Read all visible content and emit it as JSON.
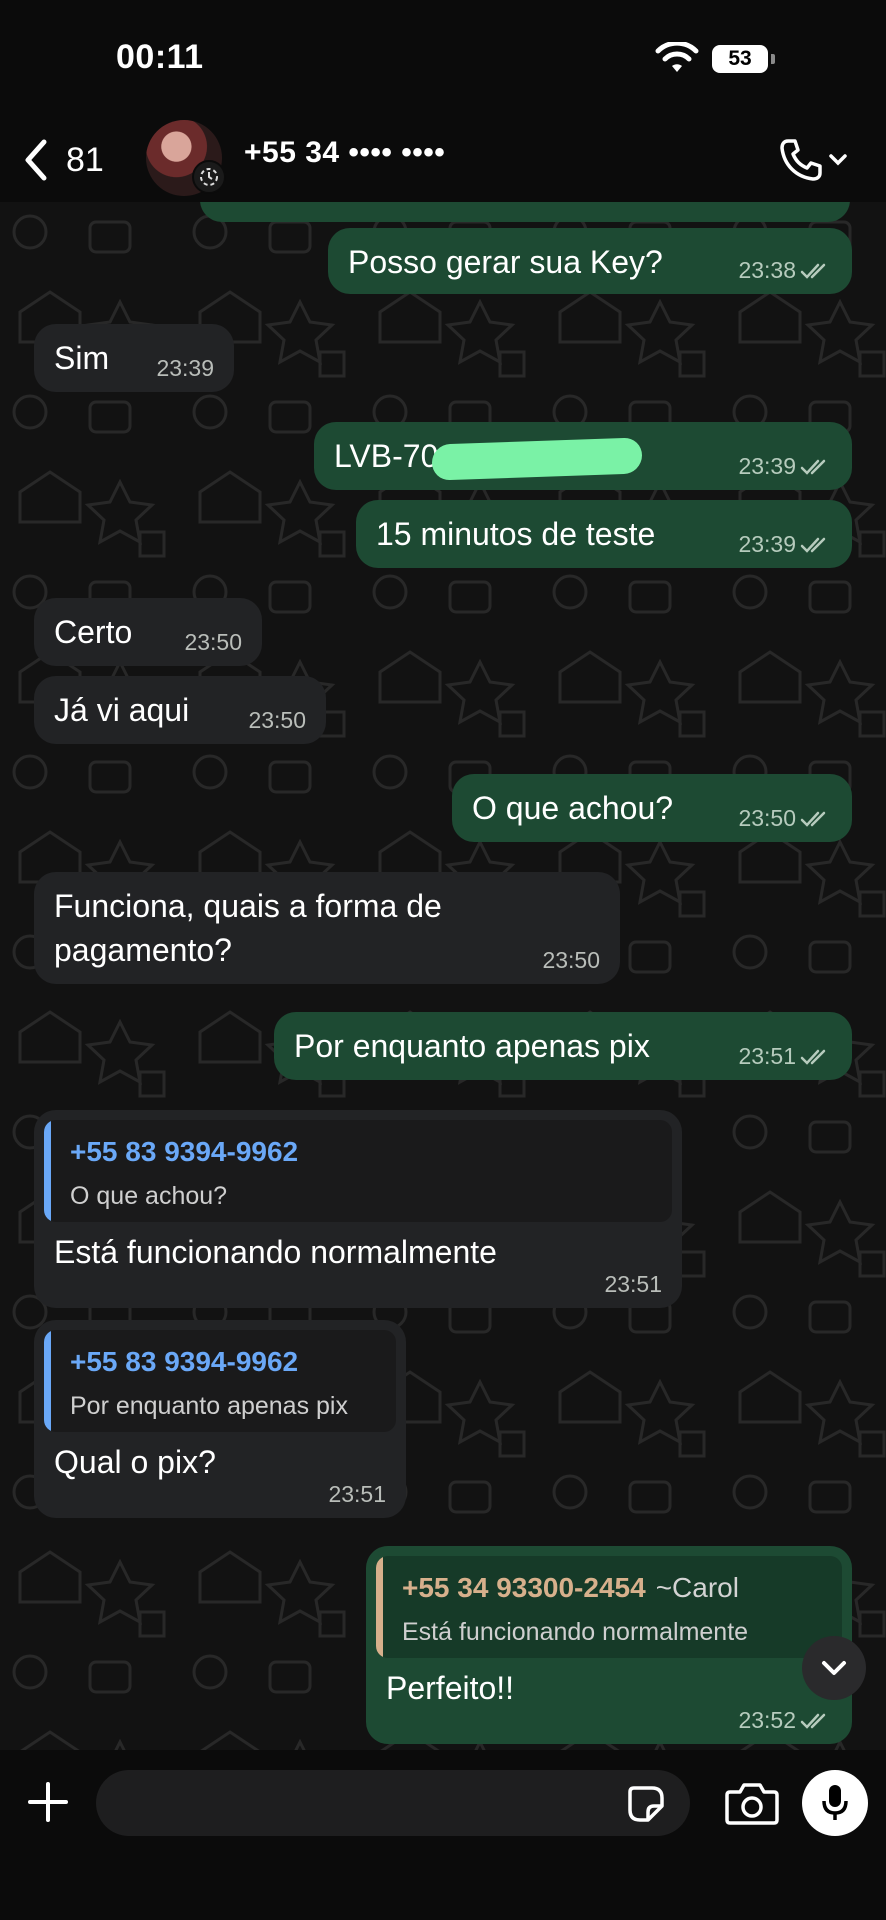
{
  "status_bar": {
    "time": "00:11",
    "battery": "53"
  },
  "header": {
    "back_count": "81",
    "contact_name": "+55 34 •••• ••••"
  },
  "messages": [
    {
      "dir": "out",
      "text": "Posso gerar sua Key?",
      "time": "23:38"
    },
    {
      "dir": "in",
      "text": "Sim",
      "time": "23:39"
    },
    {
      "dir": "out",
      "text": "LVB-70",
      "redacted": true,
      "time": "23:39"
    },
    {
      "dir": "out",
      "text": "15 minutos de teste",
      "time": "23:39"
    },
    {
      "dir": "in",
      "text": "Certo",
      "time": "23:50"
    },
    {
      "dir": "in",
      "text": "Já vi aqui",
      "time": "23:50"
    },
    {
      "dir": "out",
      "text": "O que achou?",
      "time": "23:50"
    },
    {
      "dir": "in",
      "text_line1": "Funciona, quais a forma de",
      "text_line2": "pagamento?",
      "time": "23:50"
    },
    {
      "dir": "out",
      "text": "Por enquanto apenas pix",
      "time": "23:51"
    },
    {
      "dir": "in",
      "quote_name": "+55 83 9394-9962",
      "quote_text": "O que achou?",
      "text": "Está funcionando normalmente",
      "time": "23:51"
    },
    {
      "dir": "in",
      "quote_name": "+55 83 9394-9962",
      "quote_text": "Por enquanto apenas pix",
      "text": "Qual o pix?",
      "time": "23:51"
    },
    {
      "dir": "out",
      "quote_name": "+55 34 93300-2454",
      "quote_alias": "~Carol",
      "quote_text": "Está funcionando normalmente",
      "text": "Perfeito!!",
      "time": "23:52"
    }
  ],
  "input": {
    "placeholder": ""
  },
  "colors": {
    "incoming_bubble": "#222325",
    "outgoing_bubble": "#1d4a33",
    "quote_name_blue": "#6aa8f7",
    "quote_name_tan": "#d7b08c",
    "read_ticks": "#b6cbbd"
  },
  "icons": {
    "back": "chevron-left-icon",
    "call": "phone-icon",
    "scroll": "chevron-down-icon",
    "plus": "plus-icon",
    "sticker": "sticker-icon",
    "camera": "camera-icon",
    "mic": "mic-icon"
  }
}
